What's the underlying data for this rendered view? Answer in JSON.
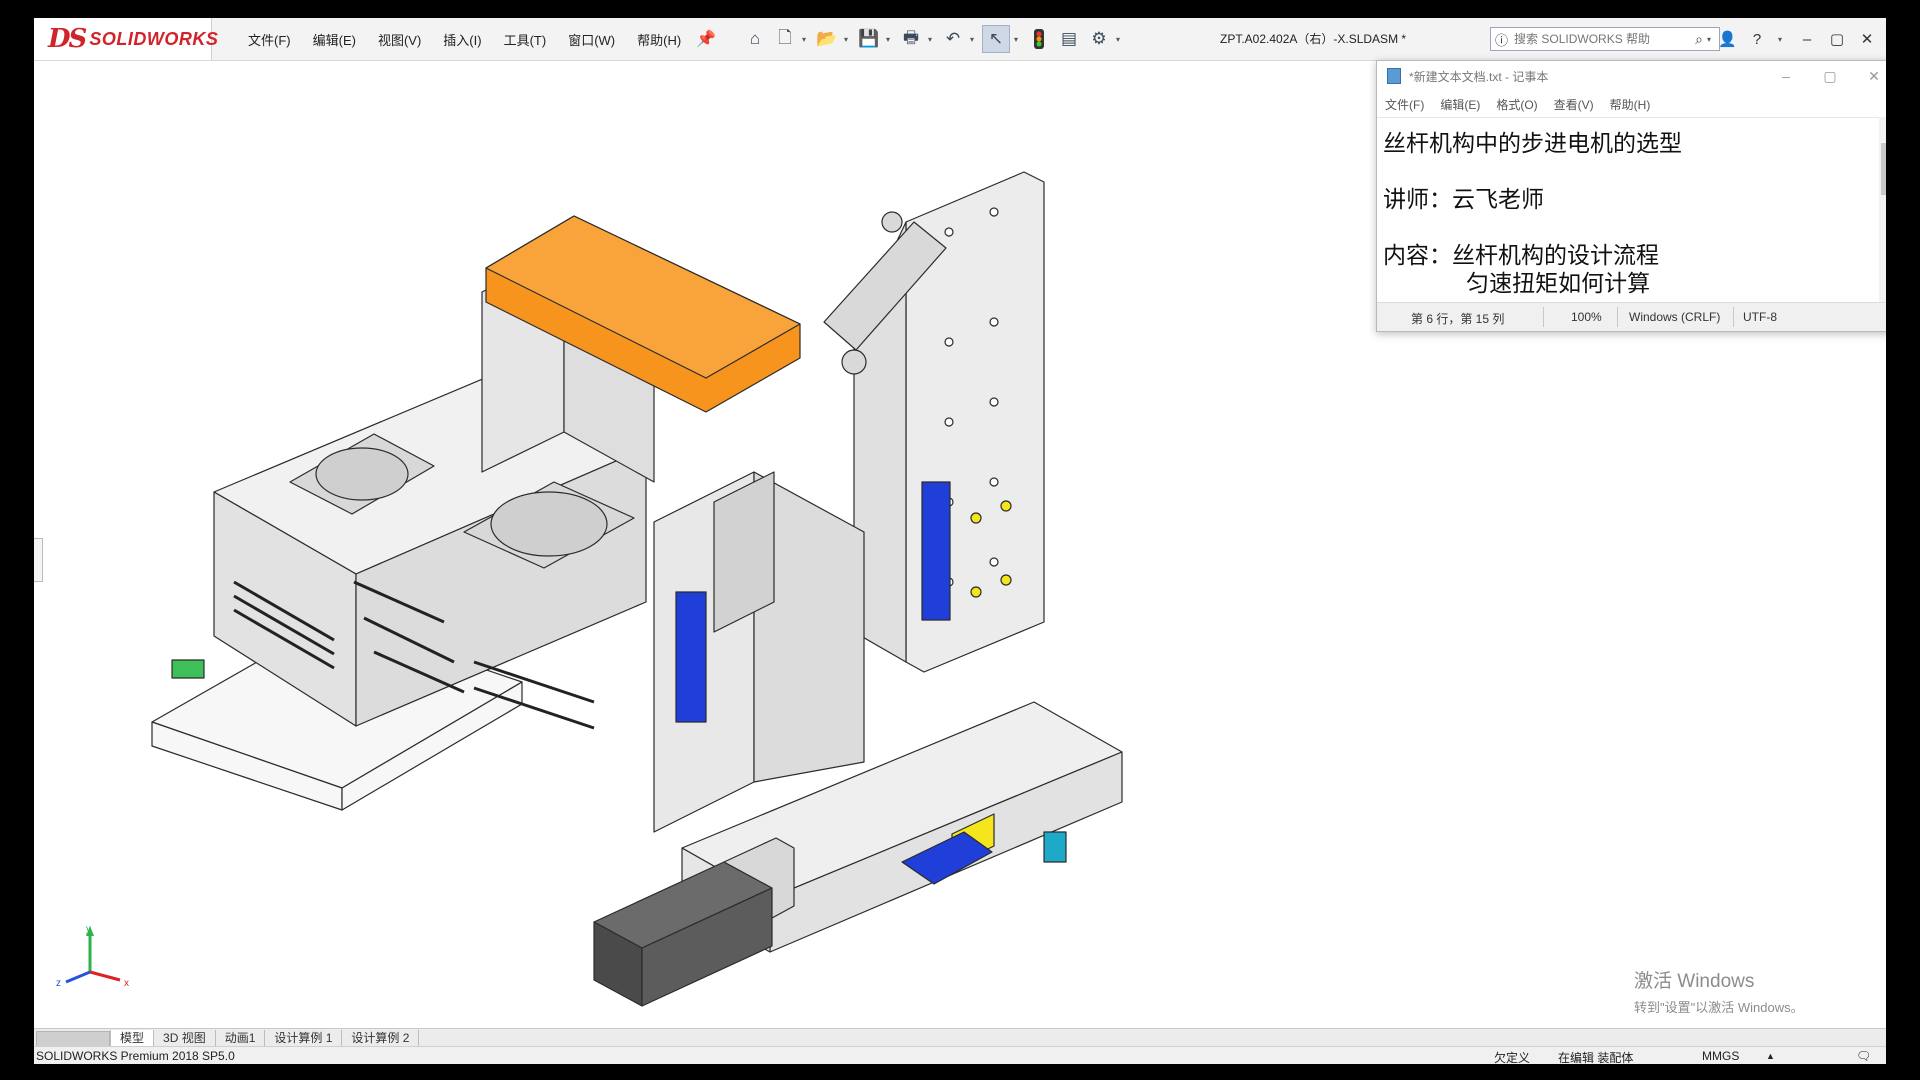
{
  "solidworks": {
    "logo_prefix": "DS",
    "logo_text": "SOLIDWORKS",
    "menus": [
      "文件(F)",
      "编辑(E)",
      "视图(V)",
      "插入(I)",
      "工具(T)",
      "窗口(W)",
      "帮助(H)"
    ],
    "document_title": "ZPT.A02.402A（右）-X.SLDASM *",
    "search_placeholder": "搜索 SOLIDWORKS 帮助",
    "quick_access_icons": [
      "home-icon",
      "new-document-icon",
      "open-icon",
      "save-icon",
      "print-icon",
      "undo-icon",
      "select-icon",
      "traffic-light-icon",
      "file-properties-icon",
      "options-gear-icon"
    ],
    "view_toolbar_icons": [
      "zoom-to-fit-icon",
      "zoom-to-area-icon",
      "previous-view-icon",
      "section-view-icon",
      "dynamic-annotation-icon",
      "view-orientation-icon",
      "display-style-icon",
      "hide-show-icon",
      "edit-appearance-icon",
      "apply-scene-icon",
      "view-settings-icon"
    ],
    "watermark_line1": "激活 Windows",
    "watermark_line2": "转到\"设置\"以激活 Windows。",
    "bottom_tabs": [
      "模型",
      "3D 视图",
      "动画1",
      "设计算例 1",
      "设计算例 2"
    ],
    "active_tab": "模型",
    "status": {
      "version": "SOLIDWORKS Premium 2018 SP5.0",
      "definition": "欠定义",
      "edit_mode": "在编辑 装配体",
      "units": "MMGS"
    }
  },
  "notepad": {
    "title": "*新建文本文档.txt - 记事本",
    "menus": [
      "文件(F)",
      "编辑(E)",
      "格式(O)",
      "查看(V)",
      "帮助(H)"
    ],
    "lines": [
      "丝杆机构中的步进电机的选型",
      "讲师：云飞老师",
      "内容：丝杆机构的设计流程",
      "      匀速扭矩如何计算"
    ],
    "status": {
      "position": "第 6 行，第 15 列",
      "zoom": "100%",
      "line_ending": "Windows (CRLF)",
      "encoding": "UTF-8"
    }
  },
  "colors": {
    "solidworks_red": "#d2232a",
    "highlight_orange": "#f7941d",
    "part_blue": "#1f3fd8",
    "part_yellow": "#f4e51c",
    "part_green": "#3dbf5a",
    "part_cyan": "#1fa9c9"
  }
}
